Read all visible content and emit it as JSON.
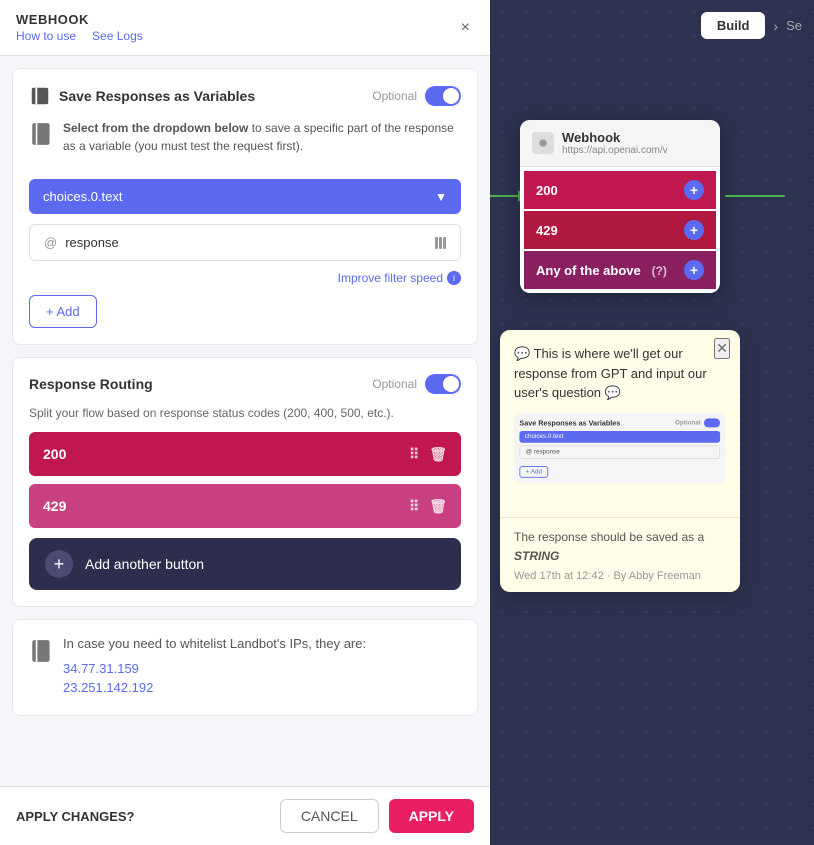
{
  "header": {
    "title": "WEBHOOK",
    "how_to_use": "How to use",
    "see_logs": "See Logs",
    "close": "×"
  },
  "nav": {
    "build": "Build",
    "arrow": "›",
    "se": "Se"
  },
  "save_responses_card": {
    "icon": "floppy-disk",
    "title": "Save Responses as Variables",
    "optional_label": "Optional",
    "info_text_bold": "Select from the dropdown below",
    "info_text": " to save a specific part of the response as a variable (you must test the request first).",
    "dropdown_value": "choices.0.text",
    "response_label": "response",
    "filter_speed": "Improve filter speed",
    "add_label": "+ Add"
  },
  "response_routing_card": {
    "title": "Response Routing",
    "optional_label": "Optional",
    "description": "Split your flow based on response status codes (200, 400, 500, etc.).",
    "btn_200": "200",
    "btn_429": "429",
    "add_another": "Add another button"
  },
  "ip_card": {
    "text": "In case you need to whitelist Landbot's IPs, they are:",
    "ip1": "34.77.31.159",
    "ip2": "23.251.142.192"
  },
  "footer": {
    "title": "APPLY CHANGES?",
    "cancel": "CANCEL",
    "apply": "APPLY"
  },
  "webhook_node": {
    "title": "Webhook",
    "subtitle": "https://api.openai.com/v",
    "btn_200": "200",
    "btn_429": "429",
    "btn_any": "Any of the above"
  },
  "tooltip": {
    "message": "💬 This is where we'll get our response from GPT and input our user's question 💬",
    "screenshot_title": "Save Responses as Variables",
    "screenshot_optional": "Optional",
    "screenshot_dropdown": "choices.0.text",
    "screenshot_field": "@ response",
    "screenshot_add": "+ Add",
    "footer_text": "The response should be saved as a STRING",
    "meta": "Wed 17th at 12:42 · By Abby Freeman"
  }
}
